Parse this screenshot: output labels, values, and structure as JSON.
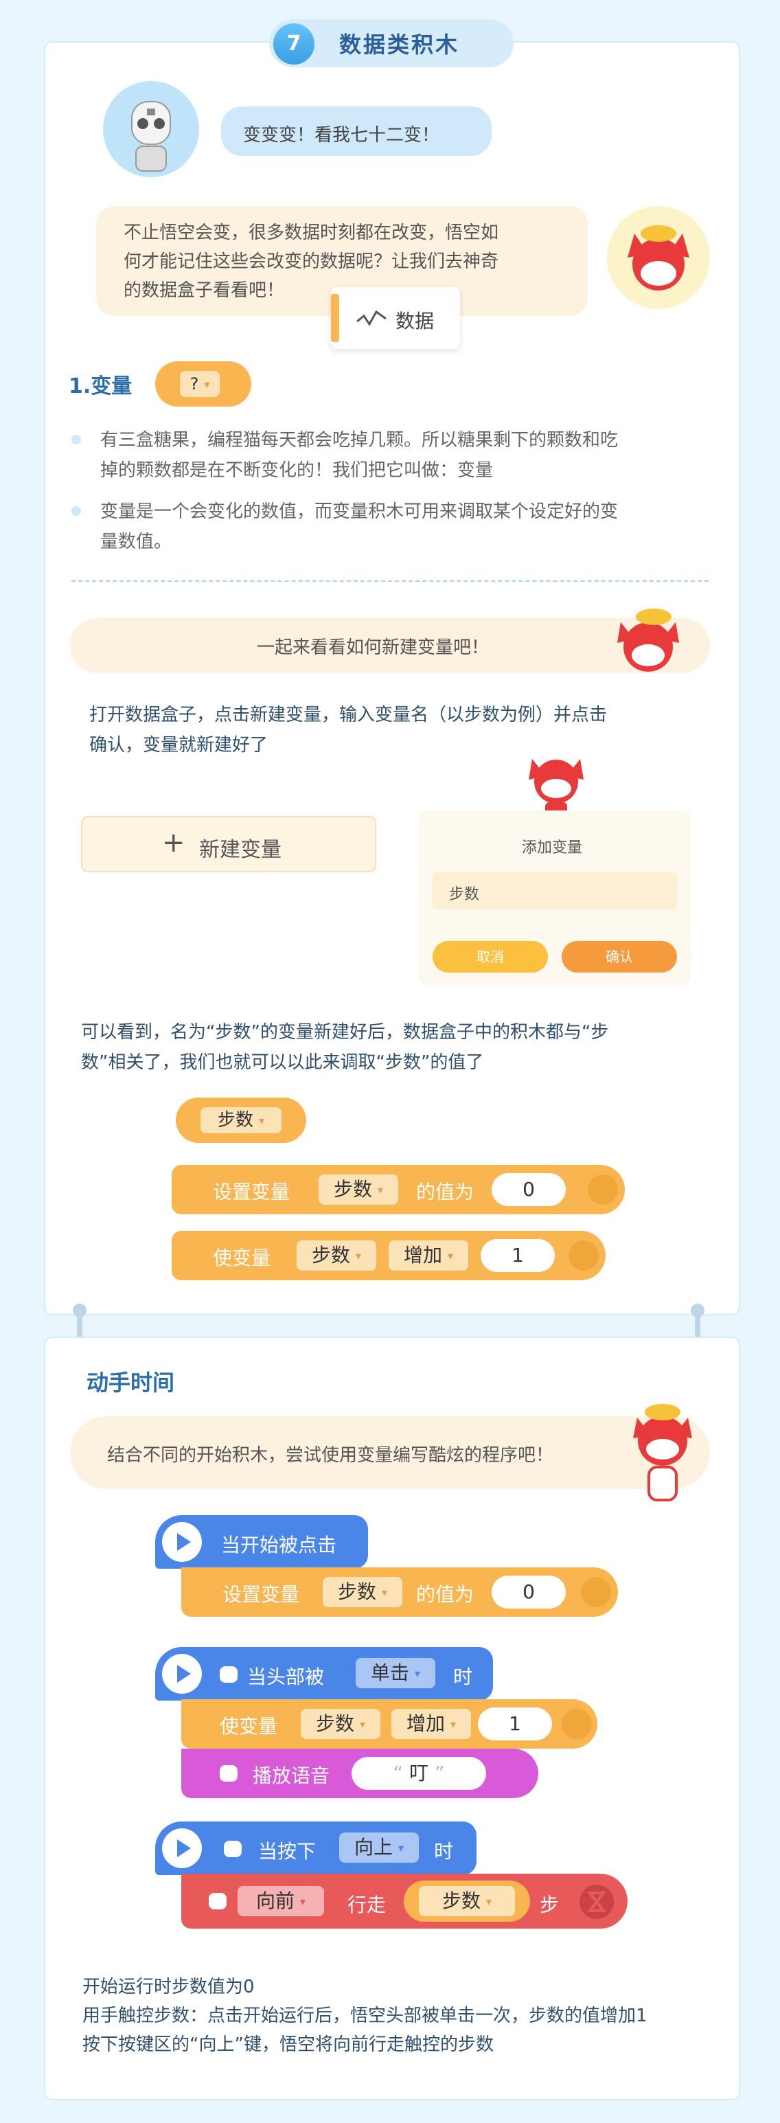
{
  "header": {
    "number": "7",
    "title": "数据类积木"
  },
  "intro": {
    "robot_speech": "变变变！看我七十二变！",
    "cat_speech_lines": [
      "不止悟空会变，很多数据时刻都在改变，悟空如",
      "何才能记住这些会改变的数据呢？让我们去神奇",
      "的数据盒子看看吧！"
    ],
    "data_tab_label": "数据"
  },
  "section1": {
    "title": "1.变量",
    "var_block": "?",
    "bullets": [
      [
        "有三盒糖果，编程猫每天都会吃掉几颗。所以糖果剩下的颗数和吃",
        "掉的颗数都是在不断变化的！我们把它叫做：变量"
      ],
      [
        "变量是一个会变化的数值，而变量积木可用来调取某个设定好的变",
        "量数值。"
      ]
    ]
  },
  "create": {
    "banner": "一起来看看如何新建变量吧！",
    "instruction_lines": [
      "打开数据盒子，点击新建变量，输入变量名（以步数为例）并点击",
      "确认，变量就新建好了"
    ],
    "new_var_button": "新建变量",
    "dialog": {
      "title": "添加变量",
      "input_value": "步数",
      "cancel": "取消",
      "confirm": "确认"
    },
    "result_lines": [
      "可以看到，名为“步数”的变量新建好后，数据盒子中的积木都与“步",
      "数”相关了，我们也就可以以此来调取“步数”的值了"
    ]
  },
  "blocks1": {
    "var": "步数",
    "set": {
      "label": "设置变量",
      "var": "步数",
      "suffix": "的值为",
      "value": "0"
    },
    "change": {
      "label": "使变量",
      "var": "步数",
      "op": "增加",
      "value": "1"
    }
  },
  "practice": {
    "title": "动手时间",
    "banner": "结合不同的开始积木，尝试使用变量编写酷炫的程序吧！",
    "script1": {
      "hat": "当开始被点击",
      "set_label": "设置变量",
      "var": "步数",
      "suffix": "的值为",
      "value": "0"
    },
    "script2": {
      "hat_prefix": "当头部被",
      "event": "单击",
      "hat_suffix": "时",
      "change_label": "使变量",
      "var": "步数",
      "op": "增加",
      "value": "1",
      "speak_label": "播放语音",
      "speak_value": "叮"
    },
    "script3": {
      "hat_prefix": "当按下",
      "key": "向上",
      "hat_suffix": "时",
      "dir": "向前",
      "walk": "行走",
      "var": "步数",
      "unit": "步"
    },
    "notes": [
      "开始运行时步数值为0",
      "用手触控步数：点击开始运行后，悟空头部被单击一次，步数的值增加1",
      "按下按键区的“向上”键，悟空将向前行走触控的步数"
    ]
  },
  "colors": {
    "orange": "#f8b550",
    "blue": "#4a85e8",
    "pink": "#d95ad8",
    "red": "#e8595a",
    "title": "#2b6ea8"
  }
}
